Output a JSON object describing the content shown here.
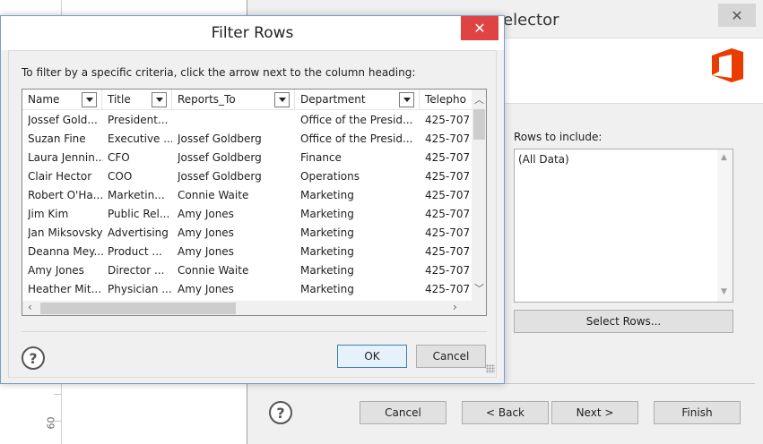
{
  "background": {
    "ruler_number": "60"
  },
  "wizard": {
    "title": "elector",
    "close_glyph": "✕",
    "rows_label": "Rows to include:",
    "rows_items": [
      "(All Data)"
    ],
    "select_rows_label": "Select Rows...",
    "help_glyph": "?",
    "buttons": {
      "cancel": "Cancel",
      "back": "< Back",
      "next": "Next >",
      "finish": "Finish"
    },
    "logo_color": "#eb3c00"
  },
  "dialog": {
    "title": "Filter Rows",
    "close_glyph": "✕",
    "instruction": "To filter by a specific criteria, click the arrow next to the column heading:",
    "columns": [
      "Name",
      "Title",
      "Reports_To",
      "Department",
      "Telepho"
    ],
    "rows": [
      [
        "Jossef Gold...",
        "President...",
        "",
        "Office of the Presid...",
        "425-707"
      ],
      [
        "Suzan Fine",
        "Executive ...",
        "Jossef Goldberg",
        "Office of the Presid...",
        "425-707"
      ],
      [
        "Laura Jennin...",
        "CFO",
        "Jossef Goldberg",
        "Finance",
        "425-707"
      ],
      [
        "Clair Hector",
        "COO",
        "Jossef Goldberg",
        "Operations",
        "425-707"
      ],
      [
        "Robert O'Ha...",
        "Marketin...",
        "Connie Waite",
        "Marketing",
        "425-707"
      ],
      [
        "Jim Kim",
        "Public Rel...",
        "Amy Jones",
        "Marketing",
        "425-707"
      ],
      [
        "Jan Miksovsky",
        "Advertising",
        "Amy Jones",
        "Marketing",
        "425-707"
      ],
      [
        "Deanna Mey...",
        "Product ...",
        "Amy Jones",
        "Marketing",
        "425-707"
      ],
      [
        "Amy Jones",
        "Director ...",
        "Connie Waite",
        "Marketing",
        "425-707"
      ],
      [
        "Heather Mit...",
        "Physician ...",
        "Amy Jones",
        "Marketing",
        "425-707"
      ]
    ],
    "help_glyph": "?",
    "ok_label": "OK",
    "cancel_label": "Cancel",
    "accent_color": "#e04343"
  }
}
